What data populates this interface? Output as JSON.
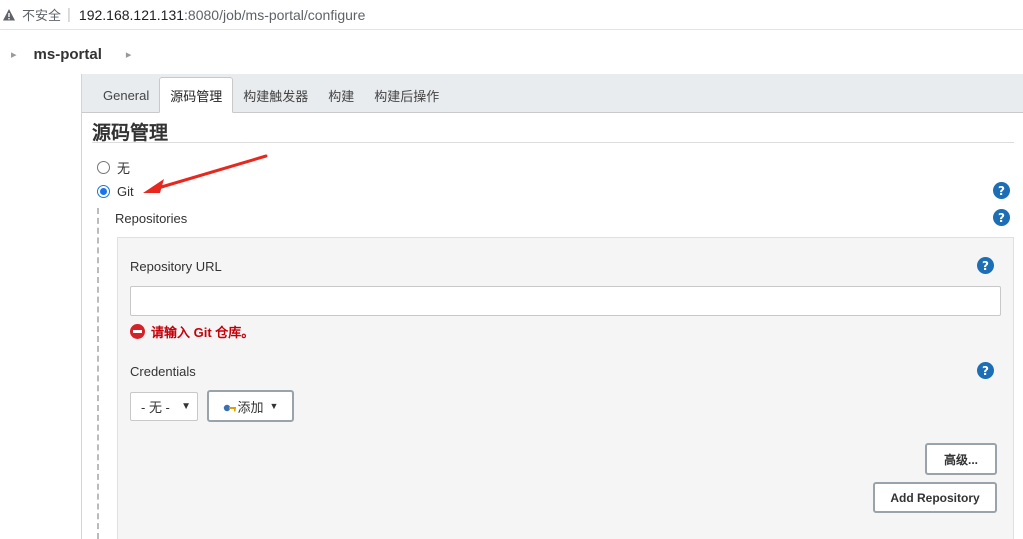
{
  "address_bar": {
    "security_label": "不安全",
    "host": "192.168.121.131",
    "path": ":8080/job/ms-portal/configure"
  },
  "breadcrumb": {
    "job_name": "ms-portal"
  },
  "tabs": [
    {
      "label": "General",
      "active": false
    },
    {
      "label": "源码管理",
      "active": true
    },
    {
      "label": "构建触发器",
      "active": false
    },
    {
      "label": "构建",
      "active": false
    },
    {
      "label": "构建后操作",
      "active": false
    }
  ],
  "scm": {
    "title": "源码管理",
    "option_none": "无",
    "option_git": "Git",
    "selected": "Git",
    "repositories_label": "Repositories",
    "repository_url_label": "Repository URL",
    "repository_url_value": "",
    "error_message": "请输入 Git 仓库。",
    "credentials_label": "Credentials",
    "credentials_selected": "- 无 -",
    "add_button_label": "添加",
    "advanced_button_label": "高级...",
    "add_repository_button_label": "Add Repository"
  },
  "colors": {
    "help_icon": "#1c6eb5",
    "error": "#c4000a",
    "annotation_arrow": "#e8281e",
    "radio_selected": "#1a73e8"
  },
  "icons": {
    "security": "warning-triangle-icon",
    "help": "question-mark-icon",
    "error": "stop-sign-icon",
    "add": "key-icon"
  }
}
